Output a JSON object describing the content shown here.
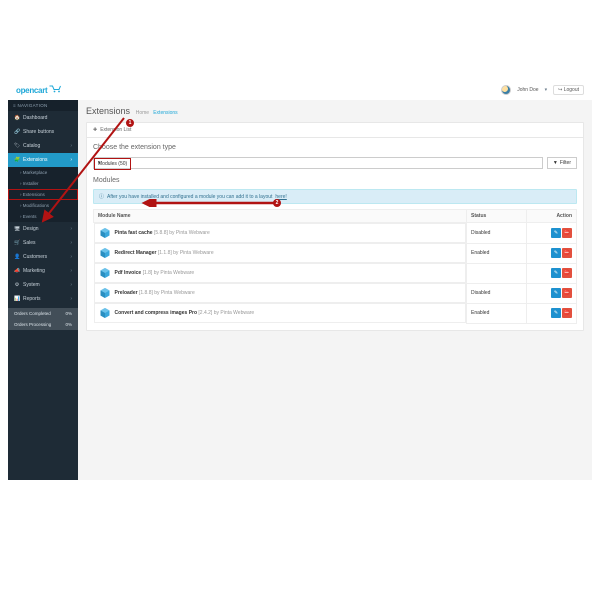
{
  "brand": "opencart",
  "user": {
    "name": "John Doe",
    "logout": "Logout"
  },
  "nav_header": "NAVIGATION",
  "sidebar": {
    "items": [
      {
        "icon": "🏠",
        "label": "Dashboard"
      },
      {
        "icon": "🔗",
        "label": "Share buttons"
      },
      {
        "icon": "🏷",
        "label": "Catalog"
      },
      {
        "icon": "🧩",
        "label": "Extensions"
      }
    ],
    "subs": [
      "Marketplace",
      "Installer",
      "Extensions",
      "Modifications",
      "Events"
    ],
    "items2": [
      {
        "icon": "🖥",
        "label": "Design"
      },
      {
        "icon": "🛒",
        "label": "Sales"
      },
      {
        "icon": "👤",
        "label": "Customers"
      },
      {
        "icon": "📣",
        "label": "Marketing"
      },
      {
        "icon": "⚙",
        "label": "System"
      },
      {
        "icon": "📊",
        "label": "Reports"
      }
    ],
    "stats": [
      {
        "label": "Orders Completed",
        "value": "0%"
      },
      {
        "label": "Orders Processing",
        "value": "0%"
      }
    ]
  },
  "page": {
    "title": "Extensions",
    "breadcrumb_home": "Home",
    "breadcrumb_current": "Extensions",
    "panel_title": "Extension List",
    "subtitle": "Choose the extension type",
    "select_value": "Modules (50)",
    "filter_label": "Filter",
    "modules_heading": "Modules",
    "alert_text": "After you have installed and configured a module you can add it to a layout ",
    "alert_link": "here!",
    "table": {
      "col_module": "Module Name",
      "col_status": "Status",
      "col_action": "Action",
      "rows": [
        {
          "name": "Pinta fast cache",
          "meta": "[5.8.8] by Pinta Webware",
          "status": "Disabled"
        },
        {
          "name": "Redirect Manager",
          "meta": "[1.1.8] by Pinta Webware",
          "status": "Enabled"
        },
        {
          "name": "Pdf Invoice",
          "meta": "[1.8] by Pinta Webware",
          "status": ""
        },
        {
          "name": "Preloader",
          "meta": "[1.8.8] by Pinta Webware",
          "status": "Disabled"
        },
        {
          "name": "Convert and compress images Pro",
          "meta": "[2.4.2] by Pinta Webware",
          "status": "Enabled"
        }
      ]
    }
  }
}
